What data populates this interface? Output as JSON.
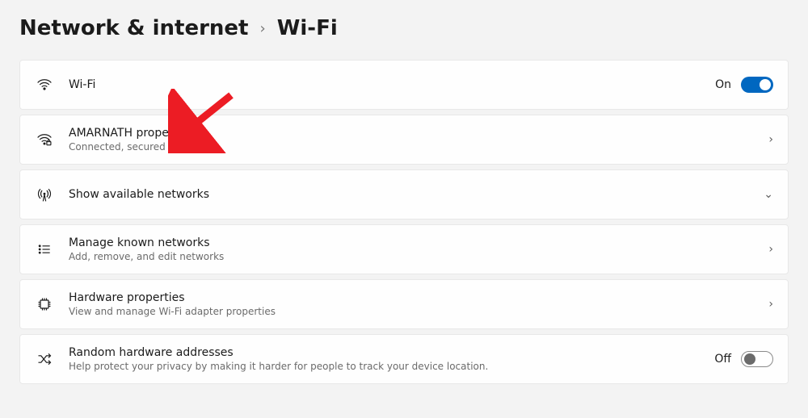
{
  "breadcrumb": {
    "parent": "Network & internet",
    "current": "Wi-Fi"
  },
  "cards": {
    "wifi": {
      "title": "Wi-Fi",
      "state": "On"
    },
    "net": {
      "title": "AMARNATH properties",
      "subtitle": "Connected, secured"
    },
    "available": {
      "title": "Show available networks"
    },
    "known": {
      "title": "Manage known networks",
      "subtitle": "Add, remove, and edit networks"
    },
    "hw": {
      "title": "Hardware properties",
      "subtitle": "View and manage Wi-Fi adapter properties"
    },
    "random": {
      "title": "Random hardware addresses",
      "subtitle": "Help protect your privacy by making it harder for people to track your device location.",
      "state": "Off"
    }
  }
}
